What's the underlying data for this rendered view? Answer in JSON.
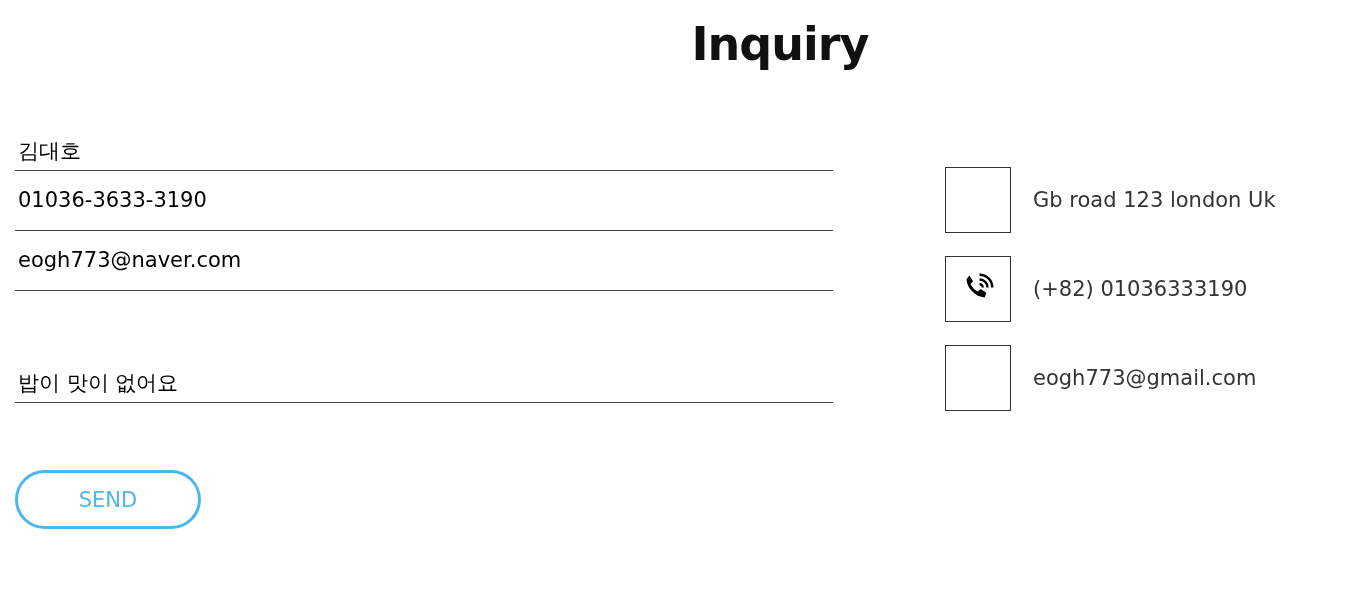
{
  "title": "Inquiry",
  "fields": [
    {
      "kind": "input",
      "value": "김대호"
    },
    {
      "kind": "input",
      "value": "01036-3633-3190"
    },
    {
      "kind": "input",
      "value": "eogh773@naver.com"
    },
    {
      "kind": "textarea",
      "value": "밥이 맛이 없어요"
    }
  ],
  "send_button": "SEND",
  "contacts": [
    {
      "kind": "address",
      "text": "Gb road 123 london Uk"
    },
    {
      "kind": "phone",
      "text": "(+82) 01036333190"
    },
    {
      "kind": "email",
      "text": "eogh773@gmail.com"
    }
  ]
}
